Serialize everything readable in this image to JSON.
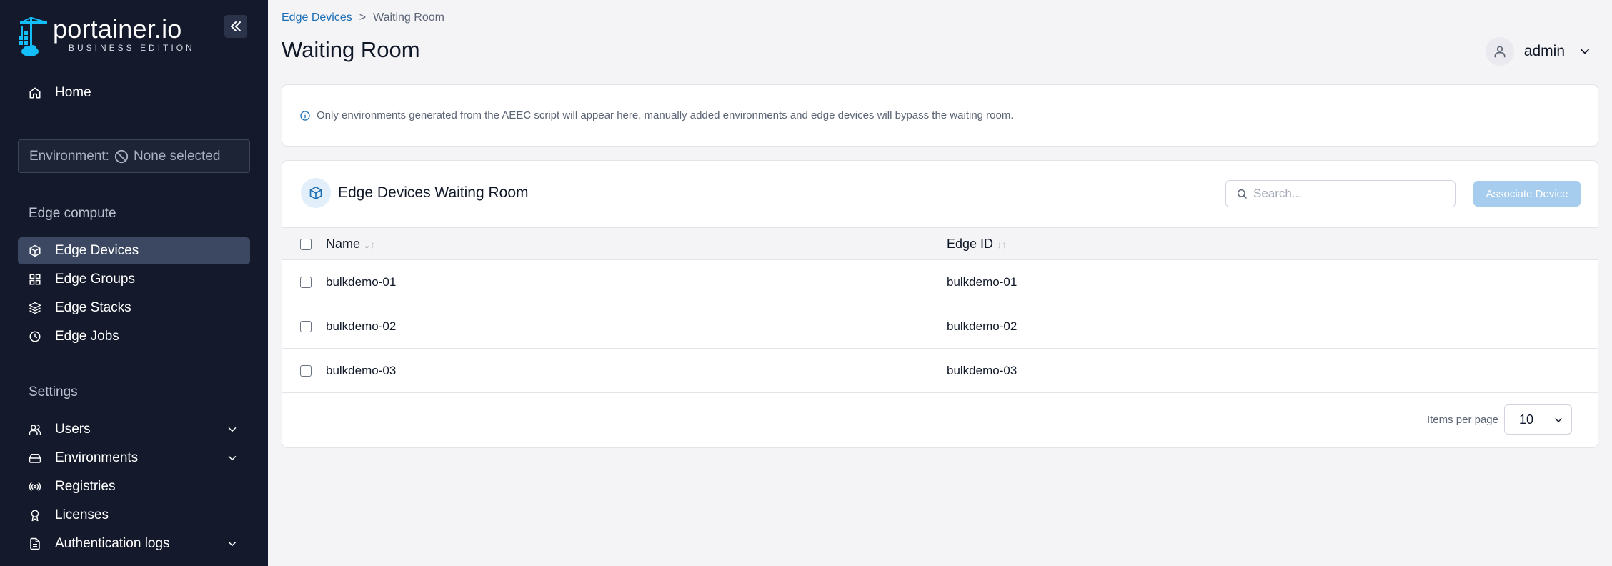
{
  "app": {
    "logo_name": "portainer.io",
    "logo_sub": "BUSINESS EDITION"
  },
  "sidebar": {
    "home_label": "Home",
    "environment_label": "Environment:",
    "environment_value": "None selected",
    "edge_section": "Edge compute",
    "edge_items": [
      {
        "label": "Edge Devices",
        "icon": "box-icon"
      },
      {
        "label": "Edge Groups",
        "icon": "grid-icon"
      },
      {
        "label": "Edge Stacks",
        "icon": "layers-icon"
      },
      {
        "label": "Edge Jobs",
        "icon": "clock-icon"
      }
    ],
    "settings_section": "Settings",
    "settings_items": [
      {
        "label": "Users",
        "icon": "users-icon"
      },
      {
        "label": "Environments",
        "icon": "hard-drive-icon"
      },
      {
        "label": "Registries",
        "icon": "radio-icon"
      },
      {
        "label": "Licenses",
        "icon": "award-icon"
      },
      {
        "label": "Authentication logs",
        "icon": "file-text-icon"
      }
    ]
  },
  "breadcrumb": {
    "parent": "Edge Devices",
    "separator": ">",
    "current": "Waiting Room"
  },
  "header": {
    "title": "Waiting Room",
    "user": "admin"
  },
  "info": {
    "text": "Only environments generated from the AEEC script will appear here, manually added environments and edge devices will bypass the waiting room."
  },
  "table": {
    "title": "Edge Devices Waiting Room",
    "search_placeholder": "Search...",
    "associate_label": "Associate Device",
    "columns": {
      "name": "Name",
      "edge_id": "Edge ID"
    },
    "rows": [
      {
        "name": "bulkdemo-01",
        "edge_id": "bulkdemo-01"
      },
      {
        "name": "bulkdemo-02",
        "edge_id": "bulkdemo-02"
      },
      {
        "name": "bulkdemo-03",
        "edge_id": "bulkdemo-03"
      }
    ],
    "items_per_page_label": "Items per page",
    "items_per_page_value": "10"
  },
  "colors": {
    "sidebar_bg": "#141a2c",
    "active_item": "#3c4862",
    "accent": "#1c6fb5",
    "button_disabled": "#a7cdee"
  }
}
